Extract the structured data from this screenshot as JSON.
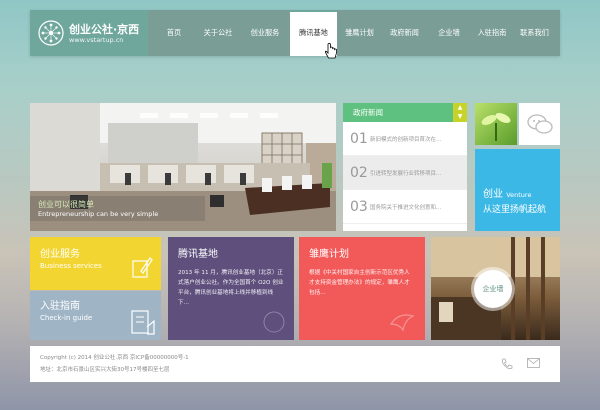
{
  "logo": {
    "name": "创业公社·京西",
    "url": "www.vstartup.cn"
  },
  "nav": {
    "items": [
      {
        "label": "首页",
        "active": false
      },
      {
        "label": "关于公社",
        "active": false
      },
      {
        "label": "创业服务",
        "active": false
      },
      {
        "label": "腾讯基地",
        "active": true
      },
      {
        "label": "雏鹰计划",
        "active": false
      },
      {
        "label": "政府新闻",
        "active": false
      },
      {
        "label": "企业墙",
        "active": false
      },
      {
        "label": "入驻指南",
        "active": false
      },
      {
        "label": "联系我们",
        "active": false
      }
    ]
  },
  "hero": {
    "caption_cn": "创业可以很简单",
    "caption_en": "Entrepreneurship can be very simple"
  },
  "news": {
    "title": "政府新闻",
    "items": [
      {
        "num": "01",
        "text": "新旧模式的创新项目首次在..."
      },
      {
        "num": "02",
        "text": "引进转型发展行业转移项目..."
      },
      {
        "num": "03",
        "text": "国务院关于推进文化创意和..."
      }
    ]
  },
  "venture": {
    "cn": "创业",
    "en": "Venture",
    "line2": "从这里扬帆起航"
  },
  "tiles": {
    "cy": {
      "title": "创业服务",
      "sub": "Business services"
    },
    "rz": {
      "title": "入驻指南",
      "sub": "Check-in guide"
    },
    "txb": {
      "title": "腾讯基地",
      "body": "2013 年 11 月，腾讯创业基地（北京）正式落户创业公社。作为全国首个 O2O 创业平台，腾讯创业基地将上线并移植到线下..."
    },
    "xy": {
      "title": "雏鹰计划",
      "body": "根据《中关村国家自主创新示范区优秀人才支持资金管理办法》的规定，雏鹰人才包括..."
    },
    "cyq": {
      "label": "企业墙"
    }
  },
  "footer": {
    "line1": "Copyright (c) 2014 创业公社.京西    京ICP备00000000号-1",
    "line2": "地址：北京市石景山区实兴大街30号17号楼四至七层"
  },
  "colors": {
    "brand": "#6fa79d",
    "news_green": "#5fc17f",
    "venture_blue": "#3cb8e6",
    "cy_yellow": "#f3d532",
    "rz_blue": "#9fb5c6",
    "txb_purple": "#5e4f7c",
    "xy_red": "#f25a5a"
  }
}
